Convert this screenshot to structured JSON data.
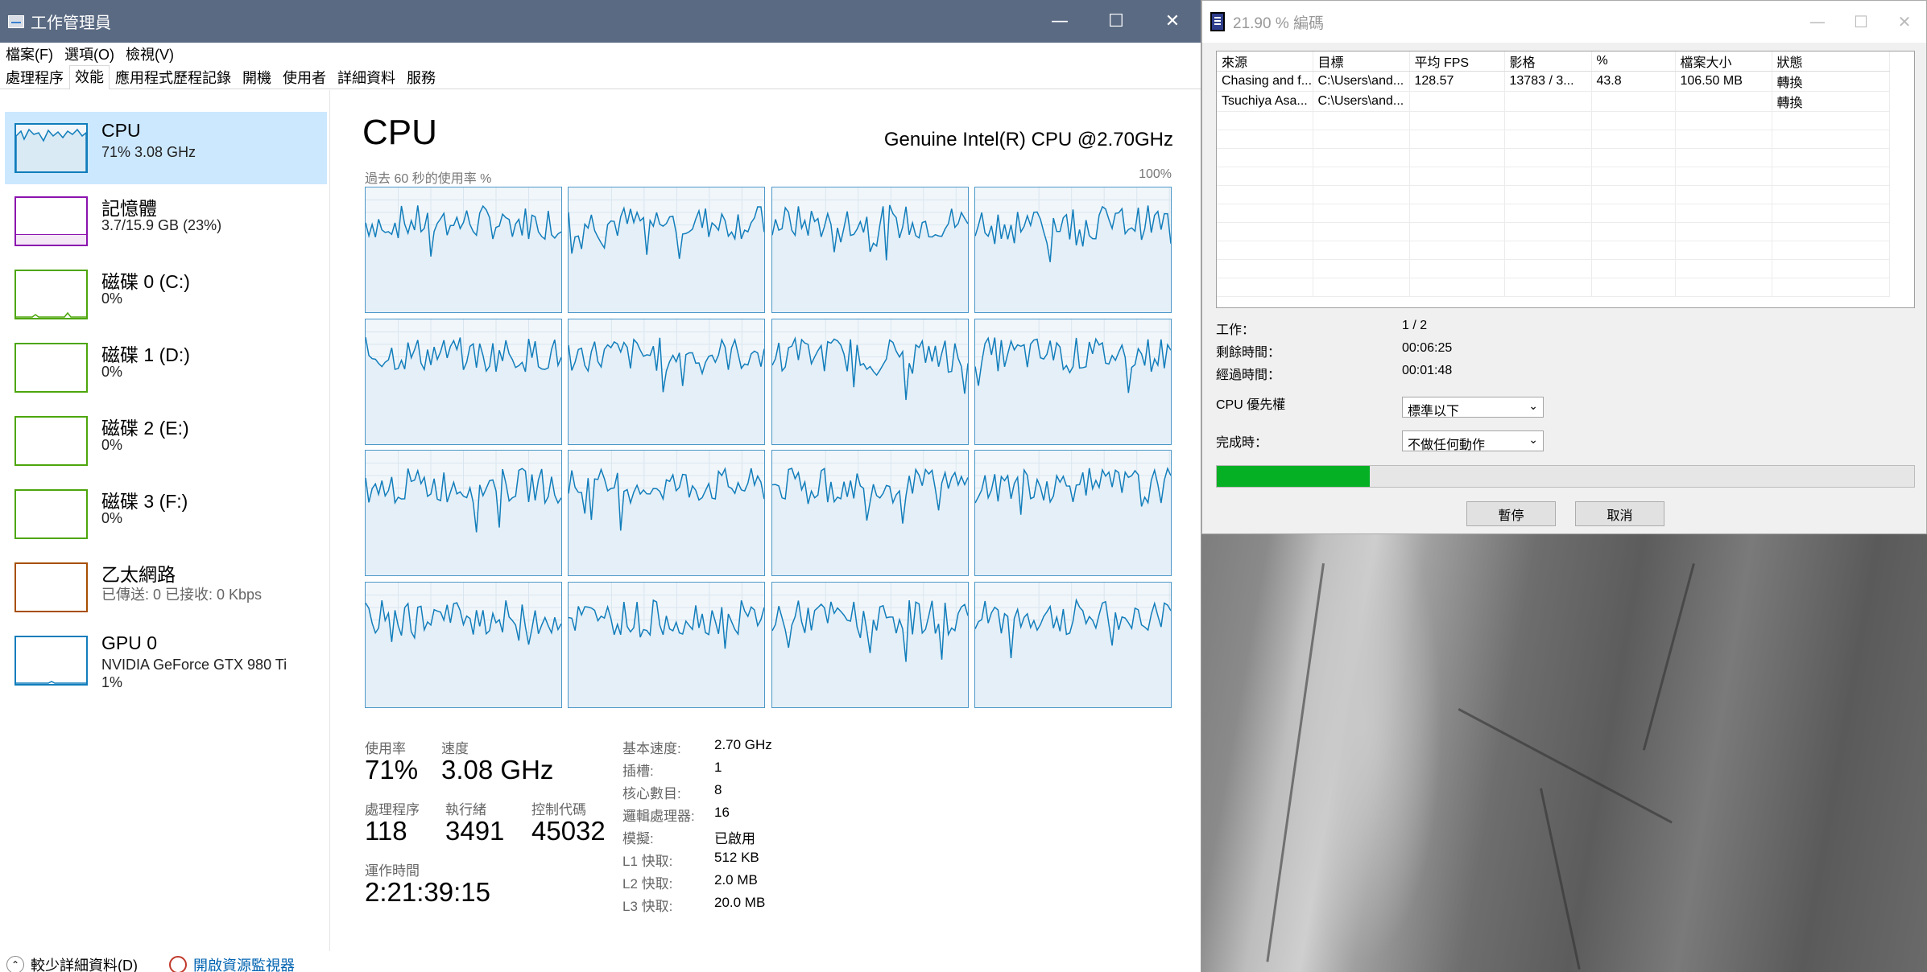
{
  "task_manager": {
    "title": "工作管理員",
    "menu": [
      "檔案(F)",
      "選項(O)",
      "檢視(V)"
    ],
    "tabs": [
      "處理程序",
      "效能",
      "應用程式歷程記錄",
      "開機",
      "使用者",
      "詳細資料",
      "服務"
    ],
    "active_tab": "效能",
    "sidebar": [
      {
        "name": "CPU",
        "sub": "71%  3.08 GHz",
        "color": "#117dbb",
        "selected": true
      },
      {
        "name": "記憶體",
        "sub": "3.7/15.9 GB (23%)",
        "color": "#8b12ae"
      },
      {
        "name": "磁碟 0 (C:)",
        "sub": "0%",
        "color": "#4da60c"
      },
      {
        "name": "磁碟 1 (D:)",
        "sub": "0%",
        "color": "#4da60c"
      },
      {
        "name": "磁碟 2 (E:)",
        "sub": "0%",
        "color": "#4da60c"
      },
      {
        "name": "磁碟 3 (F:)",
        "sub": "0%",
        "color": "#4da60c"
      },
      {
        "name": "乙太網路",
        "sub_label": "已傳送: 0 已接收: 0 Kbps",
        "sub_value": "",
        "color": "#a74f01"
      },
      {
        "name": "GPU 0",
        "sub": "NVIDIA GeForce GTX 980 Ti",
        "sub2": "1%",
        "color": "#117dbb"
      }
    ],
    "main": {
      "title": "CPU",
      "model": "Genuine Intel(R) CPU @2.70GHz",
      "graph_caption": "過去 60 秒的使用率 %",
      "graph_max": "100%",
      "stats": {
        "usage_label": "使用率",
        "usage": "71%",
        "speed_label": "速度",
        "speed": "3.08 GHz",
        "processes_label": "處理程序",
        "processes": "118",
        "threads_label": "執行緒",
        "threads": "3491",
        "handles_label": "控制代碼",
        "handles": "45032",
        "uptime_label": "運作時間",
        "uptime": "2:21:39:15"
      },
      "specs": [
        {
          "label": "基本速度:",
          "value": "2.70 GHz"
        },
        {
          "label": "插槽:",
          "value": "1"
        },
        {
          "label": "核心數目:",
          "value": "8"
        },
        {
          "label": "邏輯處理器:",
          "value": "16"
        },
        {
          "label": "模擬:",
          "value": "已啟用"
        },
        {
          "label": "L1 快取:",
          "value": "512 KB"
        },
        {
          "label": "L2 快取:",
          "value": "2.0 MB"
        },
        {
          "label": "L3 快取:",
          "value": "20.0 MB"
        }
      ]
    },
    "footer": {
      "fewer_details": "較少詳細資料(D)",
      "open_monitor": "開啟資源監視器"
    }
  },
  "encoder": {
    "title": "21.90 % 編碼",
    "columns": [
      "來源",
      "目標",
      "平均 FPS",
      "影格",
      "%",
      "檔案大小",
      "狀態"
    ],
    "rows": [
      [
        "Chasing and f...",
        "C:\\Users\\and...",
        "128.57",
        "13783 / 3...",
        "43.8",
        "106.50 MB",
        "轉換"
      ],
      [
        "Tsuchiya Asa...",
        "C:\\Users\\and...",
        "",
        "",
        "",
        "",
        "轉換"
      ]
    ],
    "job_label": "工作：",
    "job_value": "1 / 2",
    "remaining_label": "剩餘時間：",
    "remaining_value": "00:06:25",
    "elapsed_label": "經過時間：",
    "elapsed_value": "00:01:48",
    "priority_label": "CPU 優先權",
    "priority_value": "標準以下",
    "on_complete_label": "完成時：",
    "on_complete_value": "不做任何動作",
    "progress": 0.219,
    "pause_button": "暫停",
    "cancel_button": "取消"
  },
  "colors": {
    "cpu_line": "#117dbb",
    "progress": "#06b025",
    "titlebar": "#5a6a82"
  }
}
